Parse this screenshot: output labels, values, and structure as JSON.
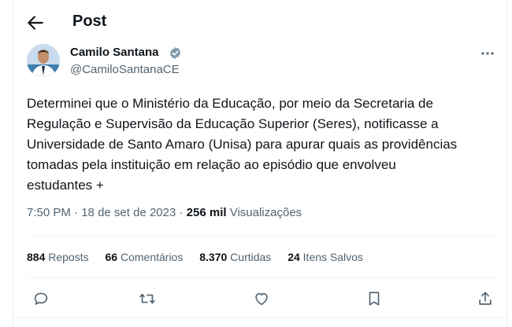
{
  "header": {
    "title": "Post",
    "back_icon": "arrow-left-icon"
  },
  "author": {
    "name": "Camilo Santana",
    "handle": "@CamiloSantanaCE",
    "verified_icon": "verified-badge-icon",
    "verified_color": "#829aab"
  },
  "post": {
    "text": "Determinei que o Ministério da Educação, por meio da Secretaria de\nRegulação e Supervisão da Educação Superior (Seres), notificasse a\nUniversidade de Santo Amaro (Unisa) para apurar quais as providências\ntomadas pela instituição em relação ao episódio que envolveu\nestudantes +",
    "time": "7:50 PM",
    "date": "18 de set de 2023",
    "views_count": "256 mil",
    "views_label": "Visualizações",
    "separator": "·"
  },
  "stats": {
    "reposts": {
      "count": "884",
      "label": "Reposts"
    },
    "comments": {
      "count": "66",
      "label": "Comentários"
    },
    "likes": {
      "count": "8.370",
      "label": "Curtidas"
    },
    "saves": {
      "count": "24",
      "label": "Itens Salvos"
    }
  },
  "actions": [
    "reply-icon",
    "repost-icon",
    "like-icon",
    "bookmark-icon",
    "share-icon"
  ],
  "colors": {
    "text": "#0f1419",
    "secondary": "#536471",
    "divider": "#eff3f4"
  }
}
